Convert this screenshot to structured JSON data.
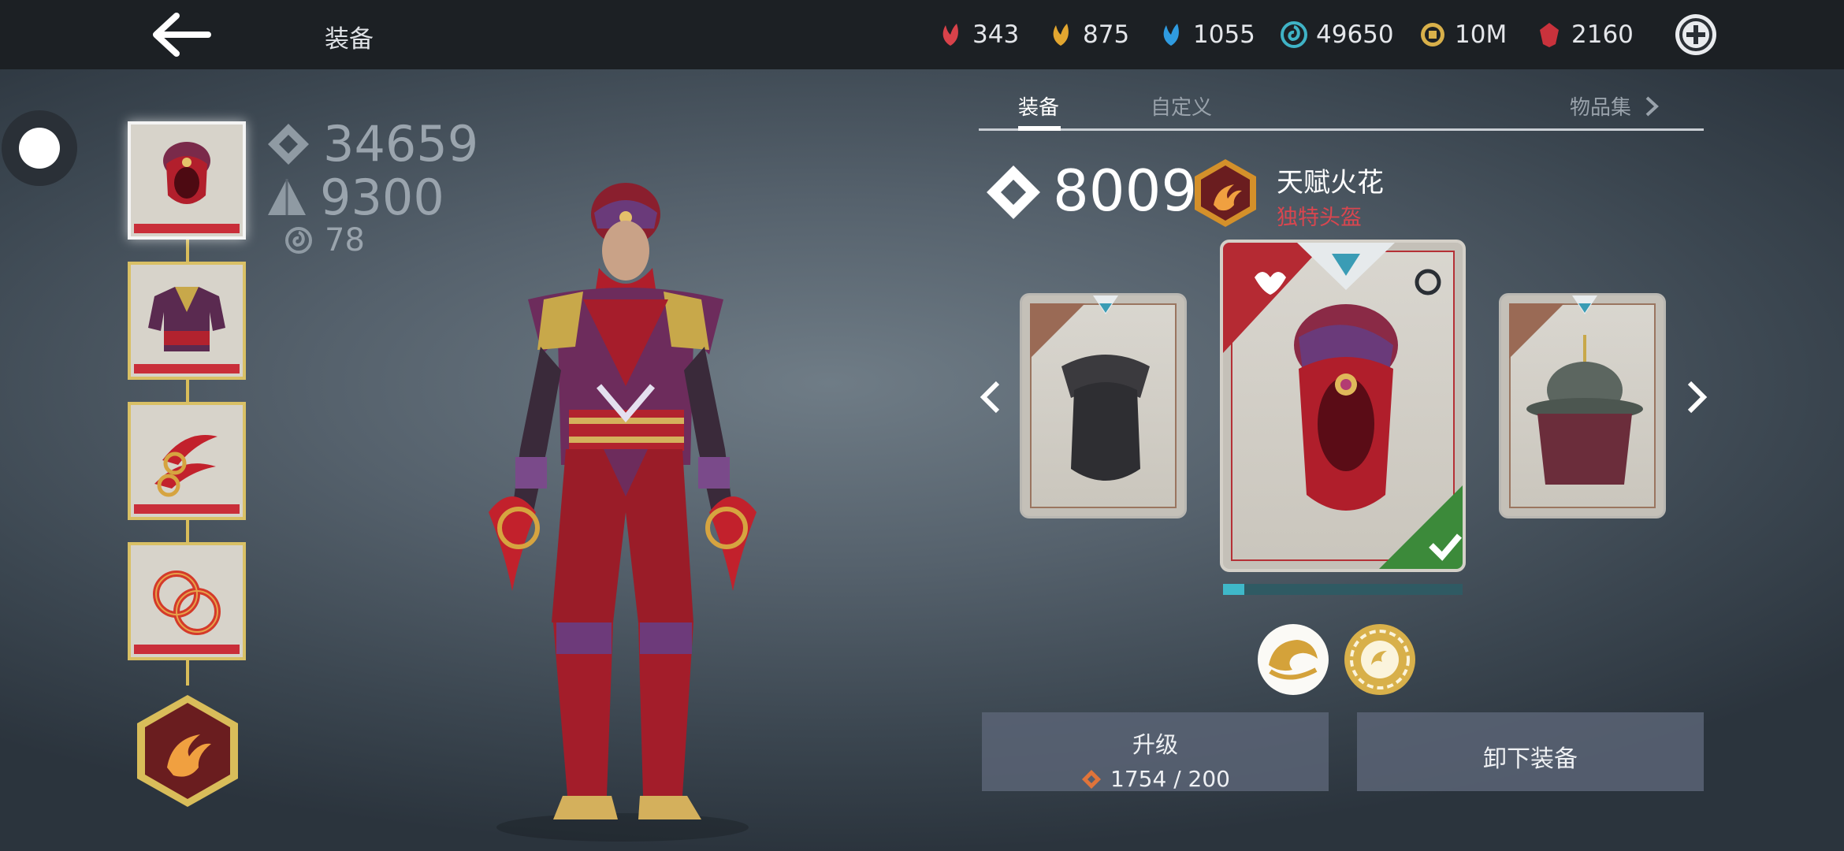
{
  "header": {
    "title": "装备",
    "resources": [
      {
        "icon": "red-crystal-icon",
        "value": "343",
        "color": "#d8424a"
      },
      {
        "icon": "gold-crystal-icon",
        "value": "875",
        "color": "#e2a630"
      },
      {
        "icon": "blue-crystal-icon",
        "value": "1055",
        "color": "#2f9be0"
      },
      {
        "icon": "swirl-icon",
        "value": "49650",
        "color": "#3fb3c6"
      },
      {
        "icon": "coin-icon",
        "value": "10M",
        "color": "#d8b04a"
      },
      {
        "icon": "ruby-icon",
        "value": "2160",
        "color": "#c9323c"
      }
    ]
  },
  "stats": {
    "power": "34659",
    "defense": "9300",
    "spirit": "78"
  },
  "tabs": {
    "equipment": "装备",
    "custom": "自定义",
    "collection": "物品集"
  },
  "item": {
    "power": "8009",
    "name": "天赋火花",
    "type": "独特头盔",
    "progress": 0.09
  },
  "buttons": {
    "upgrade": "升级",
    "upgrade_cost": "1754 / 200",
    "unequip": "卸下装备"
  },
  "colors": {
    "accent_red": "#c92e39",
    "gold": "#d9bd5a",
    "teal": "#3fb8c9"
  }
}
